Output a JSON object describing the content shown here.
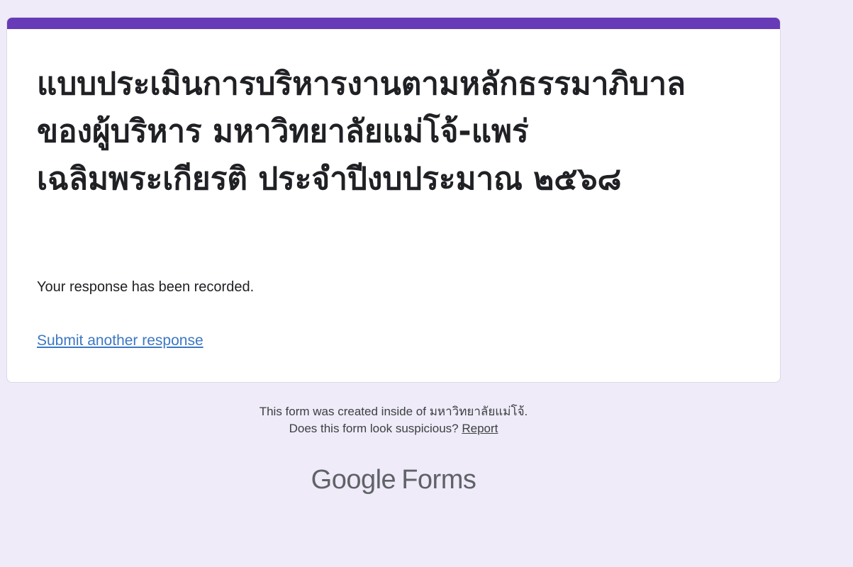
{
  "form": {
    "title": "แบบประเมินการบริหารงานตามหลักธรรมาภิบาลของผู้บริหาร มหาวิทยาลัยแม่โจ้-แพร่ เฉลิมพระเกียรติ ประจำปีงบประมาณ  ๒๕๖๘",
    "confirmation": "Your response has been recorded.",
    "submit_another_label": "Submit another response",
    "accent_color": "#673ab7"
  },
  "footer": {
    "created_inside": "This form was created inside of มหาวิทยาลัยแม่โจ้.",
    "suspicious_text": "Does this form look suspicious?",
    "report_label": "Report"
  },
  "branding": {
    "google": "Google",
    "forms": "Forms"
  }
}
